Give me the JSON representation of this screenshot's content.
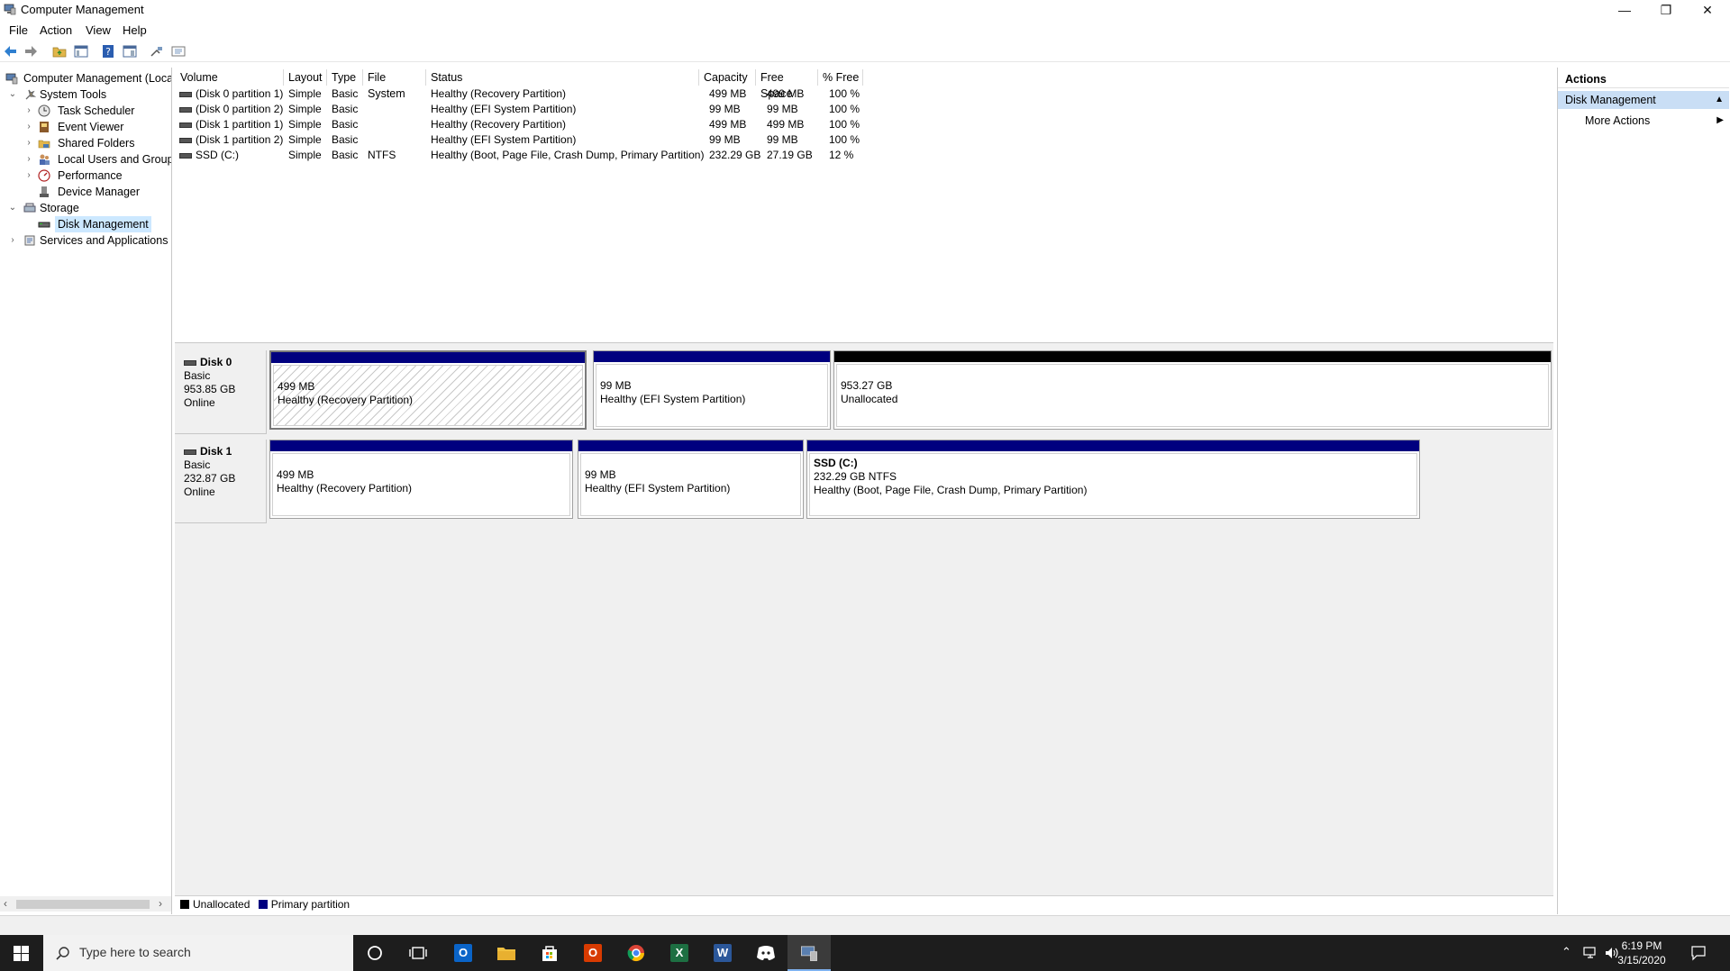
{
  "window": {
    "title": "Computer Management",
    "minimize_glyph": "—",
    "restore_glyph": "❐",
    "close_glyph": "✕"
  },
  "menu": {
    "file": "File",
    "action": "Action",
    "view": "View",
    "help": "Help"
  },
  "tree": {
    "root": "Computer Management (Local",
    "system_tools": "System Tools",
    "task_scheduler": "Task Scheduler",
    "event_viewer": "Event Viewer",
    "shared_folders": "Shared Folders",
    "local_users": "Local Users and Groups",
    "performance": "Performance",
    "device_manager": "Device Manager",
    "storage": "Storage",
    "disk_management": "Disk Management",
    "services": "Services and Applications"
  },
  "volumes": {
    "headers": [
      "Volume",
      "Layout",
      "Type",
      "File System",
      "Status",
      "Capacity",
      "Free Space",
      "% Free"
    ],
    "rows": [
      [
        "(Disk 0 partition 1)",
        "Simple",
        "Basic",
        "",
        "Healthy (Recovery Partition)",
        "499 MB",
        "499 MB",
        "100 %"
      ],
      [
        "(Disk 0 partition 2)",
        "Simple",
        "Basic",
        "",
        "Healthy (EFI System Partition)",
        "99 MB",
        "99 MB",
        "100 %"
      ],
      [
        "(Disk 1 partition 1)",
        "Simple",
        "Basic",
        "",
        "Healthy (Recovery Partition)",
        "499 MB",
        "499 MB",
        "100 %"
      ],
      [
        "(Disk 1 partition 2)",
        "Simple",
        "Basic",
        "",
        "Healthy (EFI System Partition)",
        "99 MB",
        "99 MB",
        "100 %"
      ],
      [
        "SSD (C:)",
        "Simple",
        "Basic",
        "NTFS",
        "Healthy (Boot, Page File, Crash Dump, Primary Partition)",
        "232.29 GB",
        "27.19 GB",
        "12 %"
      ]
    ]
  },
  "disks": [
    {
      "name": "Disk 0",
      "type": "Basic",
      "size": "953.85 GB",
      "state": "Online",
      "partitions": [
        {
          "size": "499 MB",
          "status": "Healthy (Recovery Partition)"
        },
        {
          "size": "99 MB",
          "status": "Healthy (EFI System Partition)"
        },
        {
          "size": "953.27 GB",
          "status": "Unallocated"
        }
      ]
    },
    {
      "name": "Disk 1",
      "type": "Basic",
      "size": "232.87 GB",
      "state": "Online",
      "partitions": [
        {
          "size": "499 MB",
          "status": "Healthy (Recovery Partition)"
        },
        {
          "size": "99 MB",
          "status": "Healthy (EFI System Partition)"
        },
        {
          "name": "SSD  (C:)",
          "size": "232.29 GB NTFS",
          "status": "Healthy (Boot, Page File, Crash Dump, Primary Partition)"
        }
      ]
    }
  ],
  "legend": {
    "unallocated": "Unallocated",
    "primary": "Primary partition"
  },
  "actions": {
    "header": "Actions",
    "section": "Disk Management",
    "more": "More Actions"
  },
  "taskbar": {
    "search_placeholder": "Type here to search",
    "time": "6:19 PM",
    "date": "3/15/2020"
  },
  "colors": {
    "primary": "#00007f",
    "unallocated": "#000000",
    "selection": "#cce8ff",
    "action_header": "#c9def5"
  }
}
